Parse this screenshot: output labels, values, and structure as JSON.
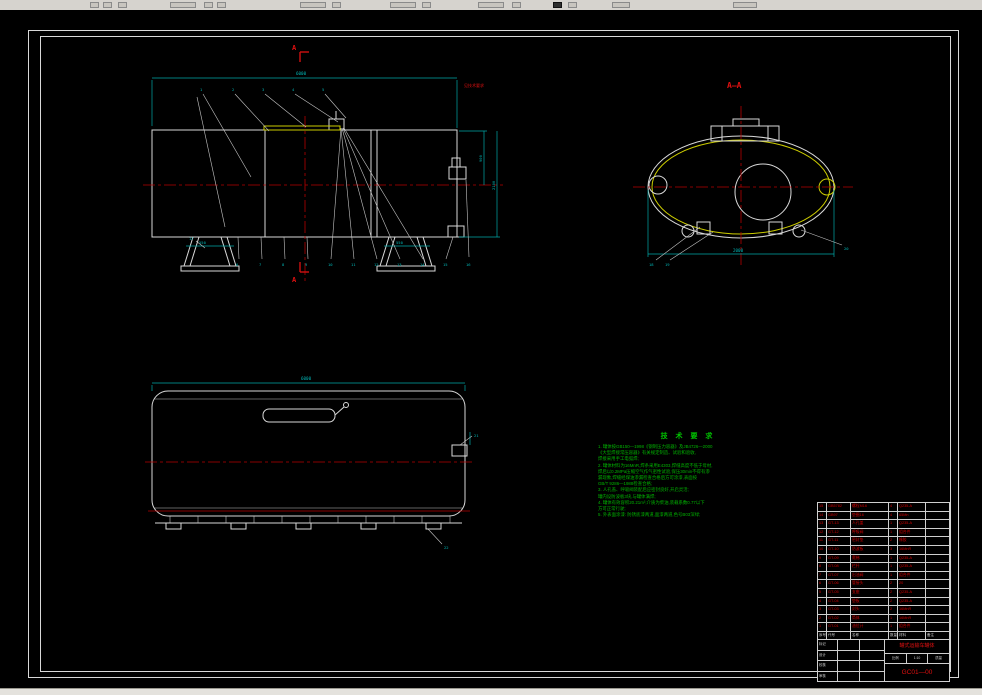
{
  "window": {
    "background": "#000000",
    "toolbar_color": "#d6d3ce"
  },
  "colors": {
    "geometry": "#d9d9d9",
    "dimension": "#00a8a8",
    "centerline": "#b40000",
    "highlight": "#cccc00",
    "notes_text": "#00b400",
    "table_text": "#d40000"
  },
  "side_view": {
    "dim_top": "6000",
    "dim_right_full": "2100",
    "dim_right_half": "900",
    "dim_leg_left": "550",
    "dim_leg_right": "550",
    "note_red": "见技术要求",
    "cut_label": "A",
    "callouts_top": [
      "1",
      "2",
      "3",
      "4",
      "5"
    ],
    "callouts_bottom": [
      "6",
      "7",
      "8",
      "9",
      "10",
      "11",
      "12",
      "13",
      "14",
      "15",
      "16"
    ],
    "callout_leg": "17"
  },
  "section_view": {
    "label": "A—A",
    "dim_bottom": "2000",
    "callouts": [
      "18",
      "19",
      "20"
    ]
  },
  "top_view": {
    "dim_top": "6000",
    "callouts": [
      "21",
      "22"
    ]
  },
  "notes": {
    "title": "技 术 要 求",
    "lines": [
      "1. 罐体按GB150—1998《钢制压力容器》及JB4726—2000",
      "《大型焊接常压容器》有关规定制造、试验和验收,",
      "焊接采用手工电弧焊;",
      "2. 罐体材料为16MnR,焊条采用E4303,焊缝高度不低于母材,",
      "焊后以0.2MPa压缩空气作气密性试验,保压30min不得有渗",
      "漏现象,焊缝经煤油渗漏检查合格后方可涂漆,表面按",
      "GB/T 9286—1988检查合格;",
      "3. 人孔盖、呼吸阀装配后应密封良好,开启灵活;",
      "罐内设防波板3块,与罐体满焊;",
      "4. 罐体有效容积20.21m³,介质为柴油,装载系数0.77以下",
      "方可正常行驶;",
      "5. 外表面涂漆: 防锈底漆两道,面漆两道,色号B03深绿;"
    ]
  },
  "parts_list": {
    "header": [
      "序号",
      "代号",
      "名称",
      "数量",
      "材料",
      "备注"
    ],
    "rows": [
      [
        "15",
        "GB5782",
        "螺栓M16",
        "4",
        "Q235-A",
        ""
      ],
      [
        "14",
        "GB97",
        "垫圈16",
        "4",
        "65Mn",
        ""
      ],
      [
        "13",
        "GT-13",
        "人孔盖",
        "1",
        "Q235-A",
        ""
      ],
      [
        "12",
        "GT-12",
        "呼吸阀",
        "1",
        "组合件",
        ""
      ],
      [
        "11",
        "GT-11",
        "密封垫",
        "2",
        "橡胶",
        ""
      ],
      [
        "10",
        "GT-10",
        "防波板",
        "3",
        "16MnR",
        ""
      ],
      [
        "9",
        "GT-09",
        "爬梯",
        "1",
        "Q235-A",
        ""
      ],
      [
        "8",
        "GT-08",
        "栏杆",
        "1",
        "Q235-A",
        ""
      ],
      [
        "7",
        "GT-07",
        "出油阀",
        "1",
        "组合件",
        ""
      ],
      [
        "6",
        "GT-06",
        "管接头",
        "2",
        "20",
        ""
      ],
      [
        "5",
        "GT-05",
        "支座",
        "2",
        "Q235-A",
        ""
      ],
      [
        "4",
        "GT-04",
        "垫板",
        "2",
        "Q235-A",
        ""
      ],
      [
        "3",
        "GT-03",
        "封头",
        "2",
        "16MnR",
        ""
      ],
      [
        "2",
        "GT-02",
        "筒体",
        "1",
        "16MnR",
        ""
      ],
      [
        "1",
        "GT-01",
        "油位计",
        "1",
        "组合件",
        ""
      ]
    ]
  },
  "title_block": {
    "name": "罐式运输车罐体",
    "code": "GC01—00",
    "scale_label": "比例",
    "scale_value": "1:10",
    "mass_label": "质量",
    "left_rows": [
      [
        "标记"
      ],
      [
        "设计"
      ],
      [
        "校核"
      ],
      [
        "审核"
      ]
    ]
  }
}
